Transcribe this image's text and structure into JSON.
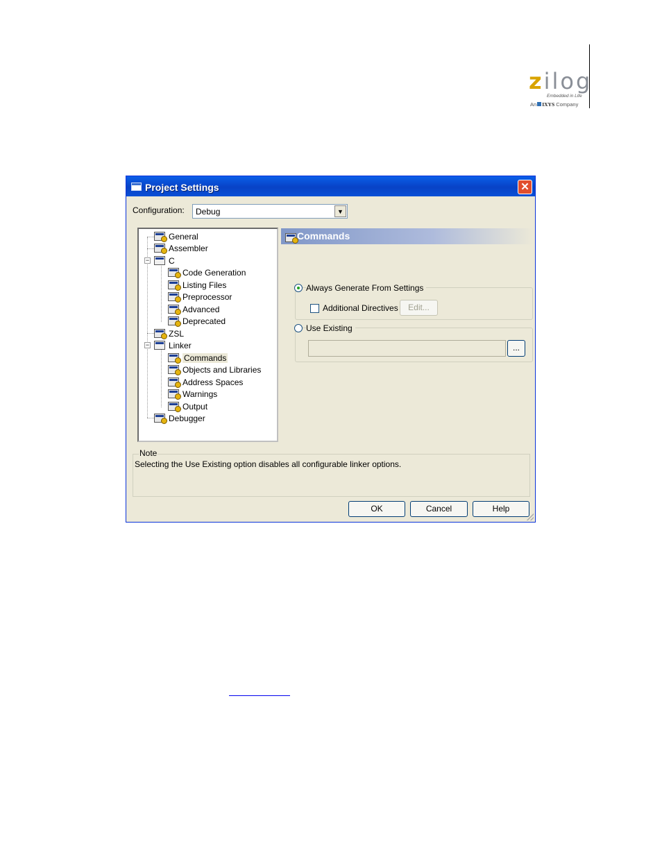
{
  "logo": {
    "wordmark_first": "z",
    "wordmark_rest": "ilog",
    "tagline": "Embedded in Life",
    "company_prefix": "An",
    "company_name": "IXYS",
    "company_suffix": "Company",
    "accent_color": "#d9a300"
  },
  "dialog": {
    "title": "Project Settings",
    "close_symbol": "✕",
    "configuration_label": "Configuration:",
    "configuration_value": "Debug",
    "dropdown_arrow": "▼",
    "tree": {
      "general": "General",
      "assembler": "Assembler",
      "c": "C",
      "code_generation": "Code Generation",
      "listing_files": "Listing Files",
      "preprocessor": "Preprocessor",
      "advanced": "Advanced",
      "deprecated": "Deprecated",
      "zsl": "ZSL",
      "linker": "Linker",
      "commands": "Commands",
      "objects_and_libraries": "Objects and Libraries",
      "address_spaces": "Address Spaces",
      "warnings": "Warnings",
      "output": "Output",
      "debugger": "Debugger",
      "expanded_symbol": "−"
    },
    "pane_title": "Commands",
    "always_generate_label": "Always Generate From Settings",
    "additional_directives_label": "Additional Directives",
    "edit_button": "Edit...",
    "use_existing_label": "Use Existing",
    "browse_button": "...",
    "note_label": "Note",
    "note_text": "Selecting the Use Existing option disables all configurable linker options.",
    "ok_button": "OK",
    "cancel_button": "Cancel",
    "help_button": "Help"
  }
}
